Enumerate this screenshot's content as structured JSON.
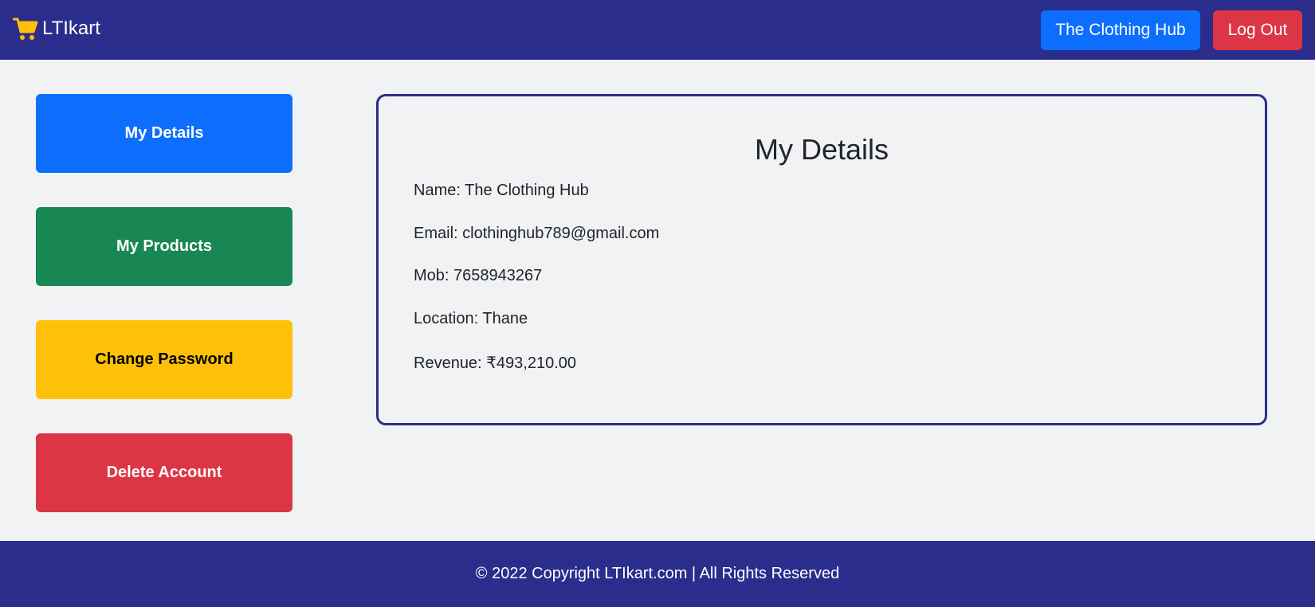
{
  "navbar": {
    "brand_icon": "shopping-cart-icon",
    "brand_label": "LTIkart",
    "store_button_label": "The Clothing Hub",
    "logout_button_label": "Log Out"
  },
  "sidebar": {
    "items": [
      {
        "label": "My Details",
        "color": "#0d6efd"
      },
      {
        "label": "My Products",
        "color": "#198754"
      },
      {
        "label": "Change Password",
        "color": "#ffc107"
      },
      {
        "label": "Delete Account",
        "color": "#dc3545"
      }
    ]
  },
  "details": {
    "title": "My Details",
    "name": "Name: The Clothing Hub",
    "email": "Email: clothinghub789@gmail.com",
    "mob": "Mob: 7658943267",
    "location": "Location: Thane",
    "revenue": "Revenue: ₹493,210.00"
  },
  "footer": {
    "text": "© 2022 Copyright LTIkart.com | All Rights Reserved"
  },
  "colors": {
    "navbar": "#2b2d8c",
    "page_background": "#f0f2f4",
    "card_border": "#2b2d8c",
    "cart_icon": "#ffc107"
  }
}
